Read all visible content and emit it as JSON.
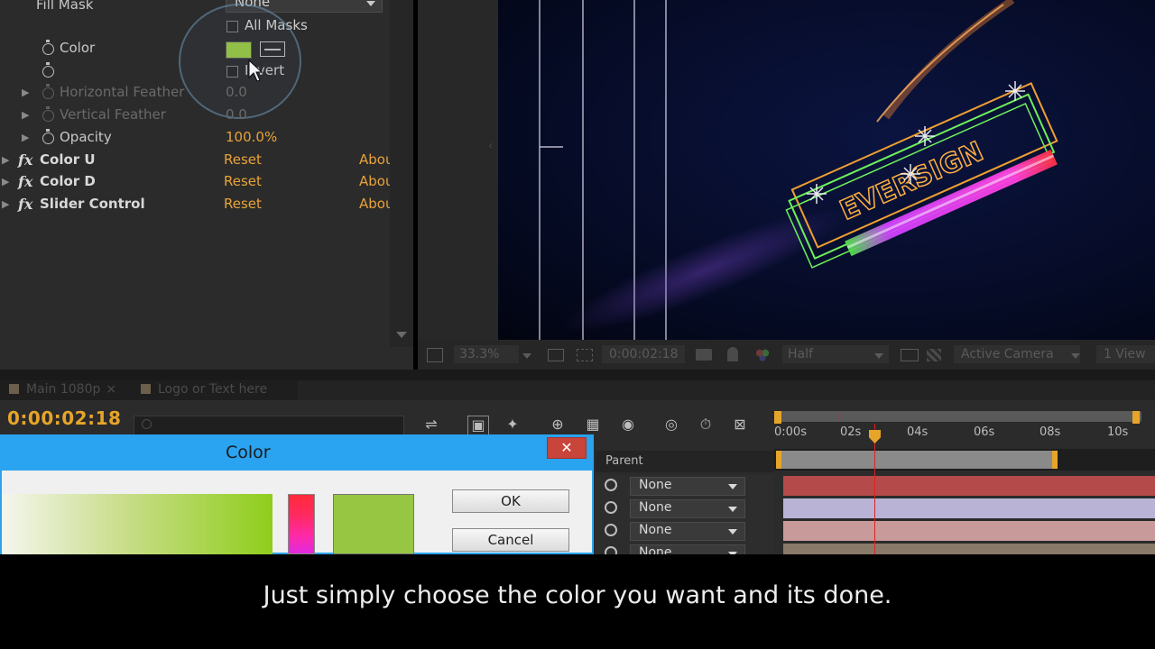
{
  "effect_controls": {
    "fill_mask": {
      "label": "Fill Mask",
      "value": "None"
    },
    "all_masks_label": "All Masks",
    "color_label": "Color",
    "color_swatch": "#97c642",
    "invert_label": "Invert",
    "horizontal_feather": {
      "label": "Horizontal Feather",
      "value": "0.0"
    },
    "vertical_feather": {
      "label": "Vertical Feather",
      "value": "0.0"
    },
    "opacity": {
      "label": "Opacity",
      "value": "100.0%"
    },
    "effects": [
      {
        "name": "Color U",
        "reset": "Reset",
        "about": "About..."
      },
      {
        "name": "Color D",
        "reset": "Reset",
        "about": "About..."
      },
      {
        "name": "Slider Control",
        "reset": "Reset",
        "about": "About..."
      }
    ]
  },
  "viewer": {
    "zoom": "33.3%",
    "timecode": "0:00:02:18",
    "resolution": "Half",
    "camera": "Active Camera",
    "views": "1 View",
    "logo_text": "EVERSIGN"
  },
  "timeline": {
    "tabs": [
      {
        "label": "Main 1080p"
      },
      {
        "label": "Logo or Text here"
      }
    ],
    "current_time": "0:00:02:18",
    "ruler_ticks": [
      "0:00s",
      "02s",
      "04s",
      "06s",
      "08s",
      "10s"
    ],
    "parent_header": "Parent",
    "parent_rows": [
      "None",
      "None",
      "None",
      "None"
    ],
    "track_colors": [
      "#b54a4a",
      "#b9b4d6",
      "#c99a9a",
      "#8a7a6a"
    ]
  },
  "color_dialog": {
    "title": "Color",
    "close": "✕",
    "ok_label": "OK",
    "cancel_label": "Cancel",
    "selected_color": "#97c642"
  },
  "subtitle": "Just simply choose the color you want and its done."
}
